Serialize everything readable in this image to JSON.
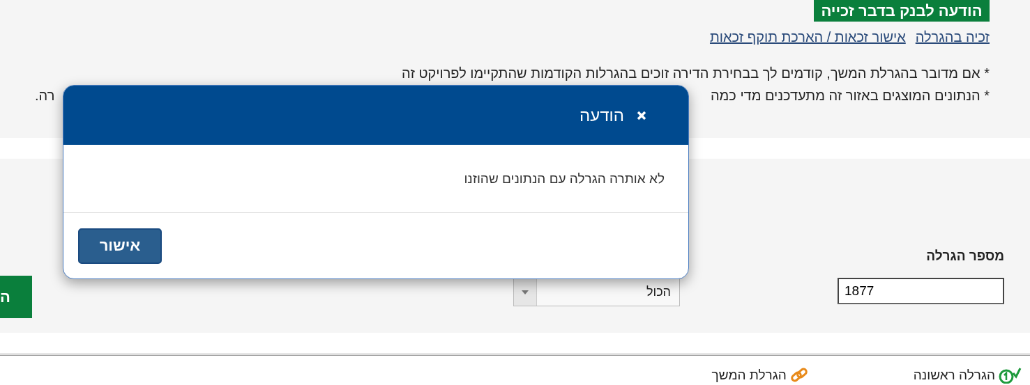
{
  "top_button": {
    "label": "הודעה לבנק בדבר זכייה"
  },
  "links": [
    "זכיה בהגרלה",
    "אישור זכאות / הארכת תוקף זכאות"
  ],
  "notes": [
    {
      "text": "* אם מדובר בהגרלת המשך, קודמים לך בבחירת הדירה זוכים בהגרלות הקודמות שהתקיימו לפרויקט זה"
    },
    {
      "text": "* הנתונים המוצגים באזור זה מתעדכנים מדי כמה",
      "tail": "רה."
    }
  ],
  "form": {
    "lottery_number": {
      "label": "מספר הגרלה",
      "value": "1877"
    },
    "select": {
      "value": "הכול"
    },
    "button": {
      "label": "ה"
    }
  },
  "legend": [
    {
      "kind": "first",
      "label": "הגרלה ראשונה"
    },
    {
      "kind": "continuation",
      "label": "הגרלת המשך"
    }
  ],
  "dialog": {
    "title": "הודעה",
    "message": "לא אותרה הגרלה עם הנתונים שהוזנו",
    "button": "אישור"
  }
}
